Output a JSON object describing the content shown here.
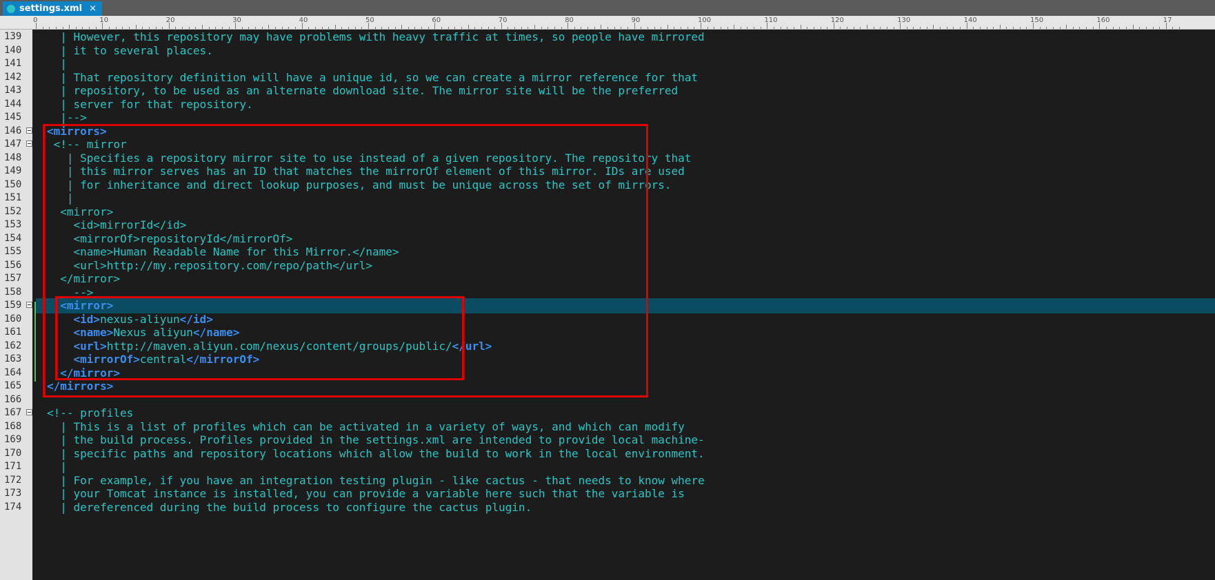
{
  "tab": {
    "filename": "settings.xml",
    "close_label": "×",
    "icon": "xml-file-icon"
  },
  "ruler": {
    "labels": [
      "0",
      "10",
      "20",
      "30",
      "40",
      "50",
      "60",
      "70",
      "80",
      "90",
      "100",
      "110",
      "120",
      "130",
      "140",
      "150",
      "160",
      "17"
    ]
  },
  "colors": {
    "background": "#1c1c1c",
    "text": "#2ec4c4",
    "tag": "#3b8ef0",
    "highlight": "#0a4d63",
    "annotation": "#e00000"
  },
  "editor": {
    "highlighted_line": "159",
    "lines": [
      {
        "n": "139",
        "fold": false,
        "text": "  | However, this repository may have problems with heavy traffic at times, so people have mirrored"
      },
      {
        "n": "140",
        "fold": false,
        "text": "  | it to several places."
      },
      {
        "n": "141",
        "fold": false,
        "text": "  |"
      },
      {
        "n": "142",
        "fold": false,
        "text": "  | That repository definition will have a unique id, so we can create a mirror reference for that"
      },
      {
        "n": "143",
        "fold": false,
        "text": "  | repository, to be used as an alternate download site. The mirror site will be the preferred"
      },
      {
        "n": "144",
        "fold": false,
        "text": "  | server for that repository."
      },
      {
        "n": "145",
        "fold": false,
        "text": "  |-->"
      },
      {
        "n": "146",
        "fold": true,
        "text": "<mirrors>"
      },
      {
        "n": "147",
        "fold": true,
        "text": " <!-- mirror"
      },
      {
        "n": "148",
        "fold": false,
        "text": "   | Specifies a repository mirror site to use instead of a given repository. The repository that"
      },
      {
        "n": "149",
        "fold": false,
        "text": "   | this mirror serves has an ID that matches the mirrorOf element of this mirror. IDs are used"
      },
      {
        "n": "150",
        "fold": false,
        "text": "   | for inheritance and direct lookup purposes, and must be unique across the set of mirrors."
      },
      {
        "n": "151",
        "fold": false,
        "text": "   |"
      },
      {
        "n": "152",
        "fold": false,
        "text": "  <mirror>"
      },
      {
        "n": "153",
        "fold": false,
        "text": "    <id>mirrorId</id>"
      },
      {
        "n": "154",
        "fold": false,
        "text": "    <mirrorOf>repositoryId</mirrorOf>"
      },
      {
        "n": "155",
        "fold": false,
        "text": "    <name>Human Readable Name for this Mirror.</name>"
      },
      {
        "n": "156",
        "fold": false,
        "text": "    <url>http://my.repository.com/repo/path</url>"
      },
      {
        "n": "157",
        "fold": false,
        "text": "  </mirror>"
      },
      {
        "n": "158",
        "fold": false,
        "text": "    -->"
      },
      {
        "n": "159",
        "fold": true,
        "text": "  <mirror>"
      },
      {
        "n": "160",
        "fold": false,
        "text": "    <id>nexus-aliyun</id>"
      },
      {
        "n": "161",
        "fold": false,
        "text": "    <name>Nexus aliyun</name>"
      },
      {
        "n": "162",
        "fold": false,
        "text": "    <url>http://maven.aliyun.com/nexus/content/groups/public/</url>"
      },
      {
        "n": "163",
        "fold": false,
        "text": "    <mirrorOf>central</mirrorOf>"
      },
      {
        "n": "164",
        "fold": false,
        "text": "  </mirror>"
      },
      {
        "n": "165",
        "fold": false,
        "text": "</mirrors>"
      },
      {
        "n": "166",
        "fold": false,
        "text": ""
      },
      {
        "n": "167",
        "fold": true,
        "text": "<!-- profiles"
      },
      {
        "n": "168",
        "fold": false,
        "text": "  | This is a list of profiles which can be activated in a variety of ways, and which can modify"
      },
      {
        "n": "169",
        "fold": false,
        "text": "  | the build process. Profiles provided in the settings.xml are intended to provide local machine-"
      },
      {
        "n": "170",
        "fold": false,
        "text": "  | specific paths and repository locations which allow the build to work in the local environment."
      },
      {
        "n": "171",
        "fold": false,
        "text": "  |"
      },
      {
        "n": "172",
        "fold": false,
        "text": "  | For example, if you have an integration testing plugin - like cactus - that needs to know where"
      },
      {
        "n": "173",
        "fold": false,
        "text": "  | your Tomcat instance is installed, you can provide a variable here such that the variable is"
      },
      {
        "n": "174",
        "fold": false,
        "text": "  | dereferenced during the build process to configure the cactus plugin."
      }
    ]
  }
}
